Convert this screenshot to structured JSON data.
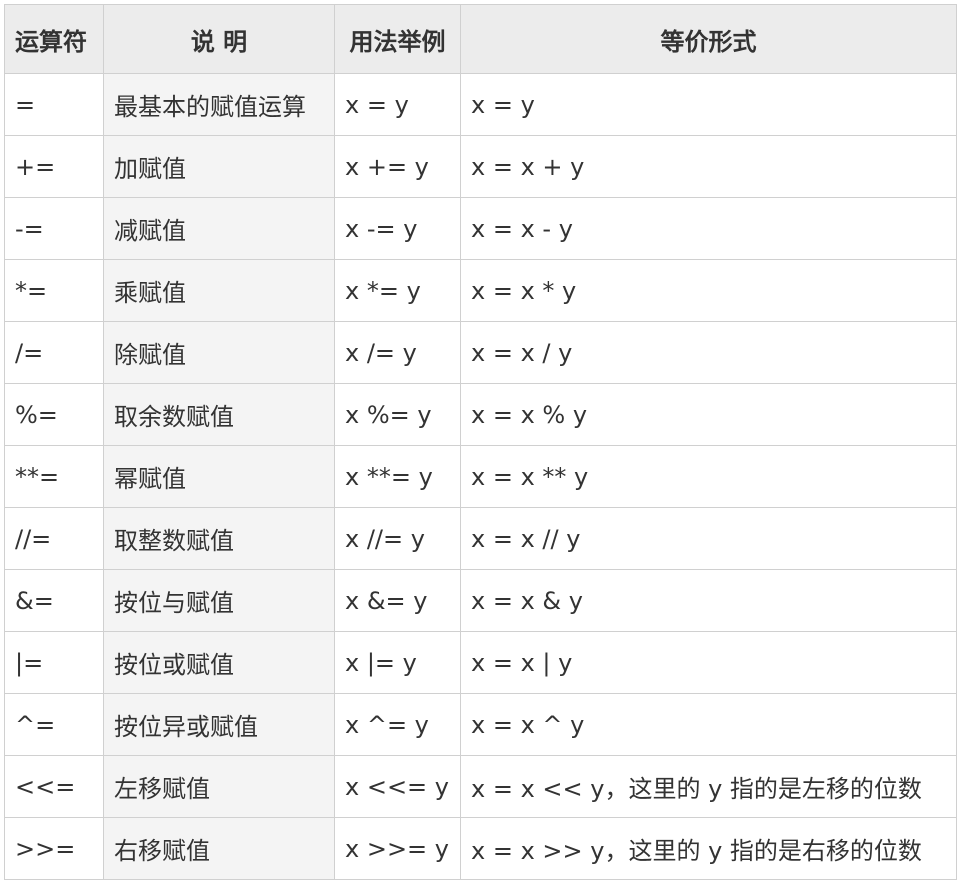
{
  "table": {
    "headers": [
      "运算符",
      "说 明",
      "用法举例",
      "等价形式"
    ],
    "rows": [
      {
        "op": "=",
        "desc": "最基本的赋值运算",
        "usage": "x = y",
        "equiv": "x = y"
      },
      {
        "op": "+=",
        "desc": "加赋值",
        "usage": "x += y",
        "equiv": "x = x + y"
      },
      {
        "op": "-=",
        "desc": "减赋值",
        "usage": "x -= y",
        "equiv": "x = x - y"
      },
      {
        "op": "*=",
        "desc": "乘赋值",
        "usage": "x *= y",
        "equiv": "x = x * y"
      },
      {
        "op": "/=",
        "desc": "除赋值",
        "usage": "x /= y",
        "equiv": "x = x / y"
      },
      {
        "op": "%=",
        "desc": "取余数赋值",
        "usage": "x %= y",
        "equiv": "x = x % y"
      },
      {
        "op": "**=",
        "desc": "幂赋值",
        "usage": "x **= y",
        "equiv": "x = x ** y"
      },
      {
        "op": "//=",
        "desc": "取整数赋值",
        "usage": "x //= y",
        "equiv": "x = x // y"
      },
      {
        "op": "&=",
        "desc": "按位与赋值",
        "usage": "x &= y",
        "equiv": "x = x & y"
      },
      {
        "op": "|=",
        "desc": "按位或赋值",
        "usage": "x |= y",
        "equiv": "x = x | y"
      },
      {
        "op": "^=",
        "desc": "按位异或赋值",
        "usage": "x ^= y",
        "equiv": "x = x ^ y"
      },
      {
        "op": "<<=",
        "desc": "左移赋值",
        "usage": "x <<= y",
        "equiv": "x = x << y，这里的 y 指的是左移的位数"
      },
      {
        "op": ">>=",
        "desc": "右移赋值",
        "usage": "x >>= y",
        "equiv": "x = x >> y，这里的 y 指的是右移的位数"
      }
    ]
  }
}
